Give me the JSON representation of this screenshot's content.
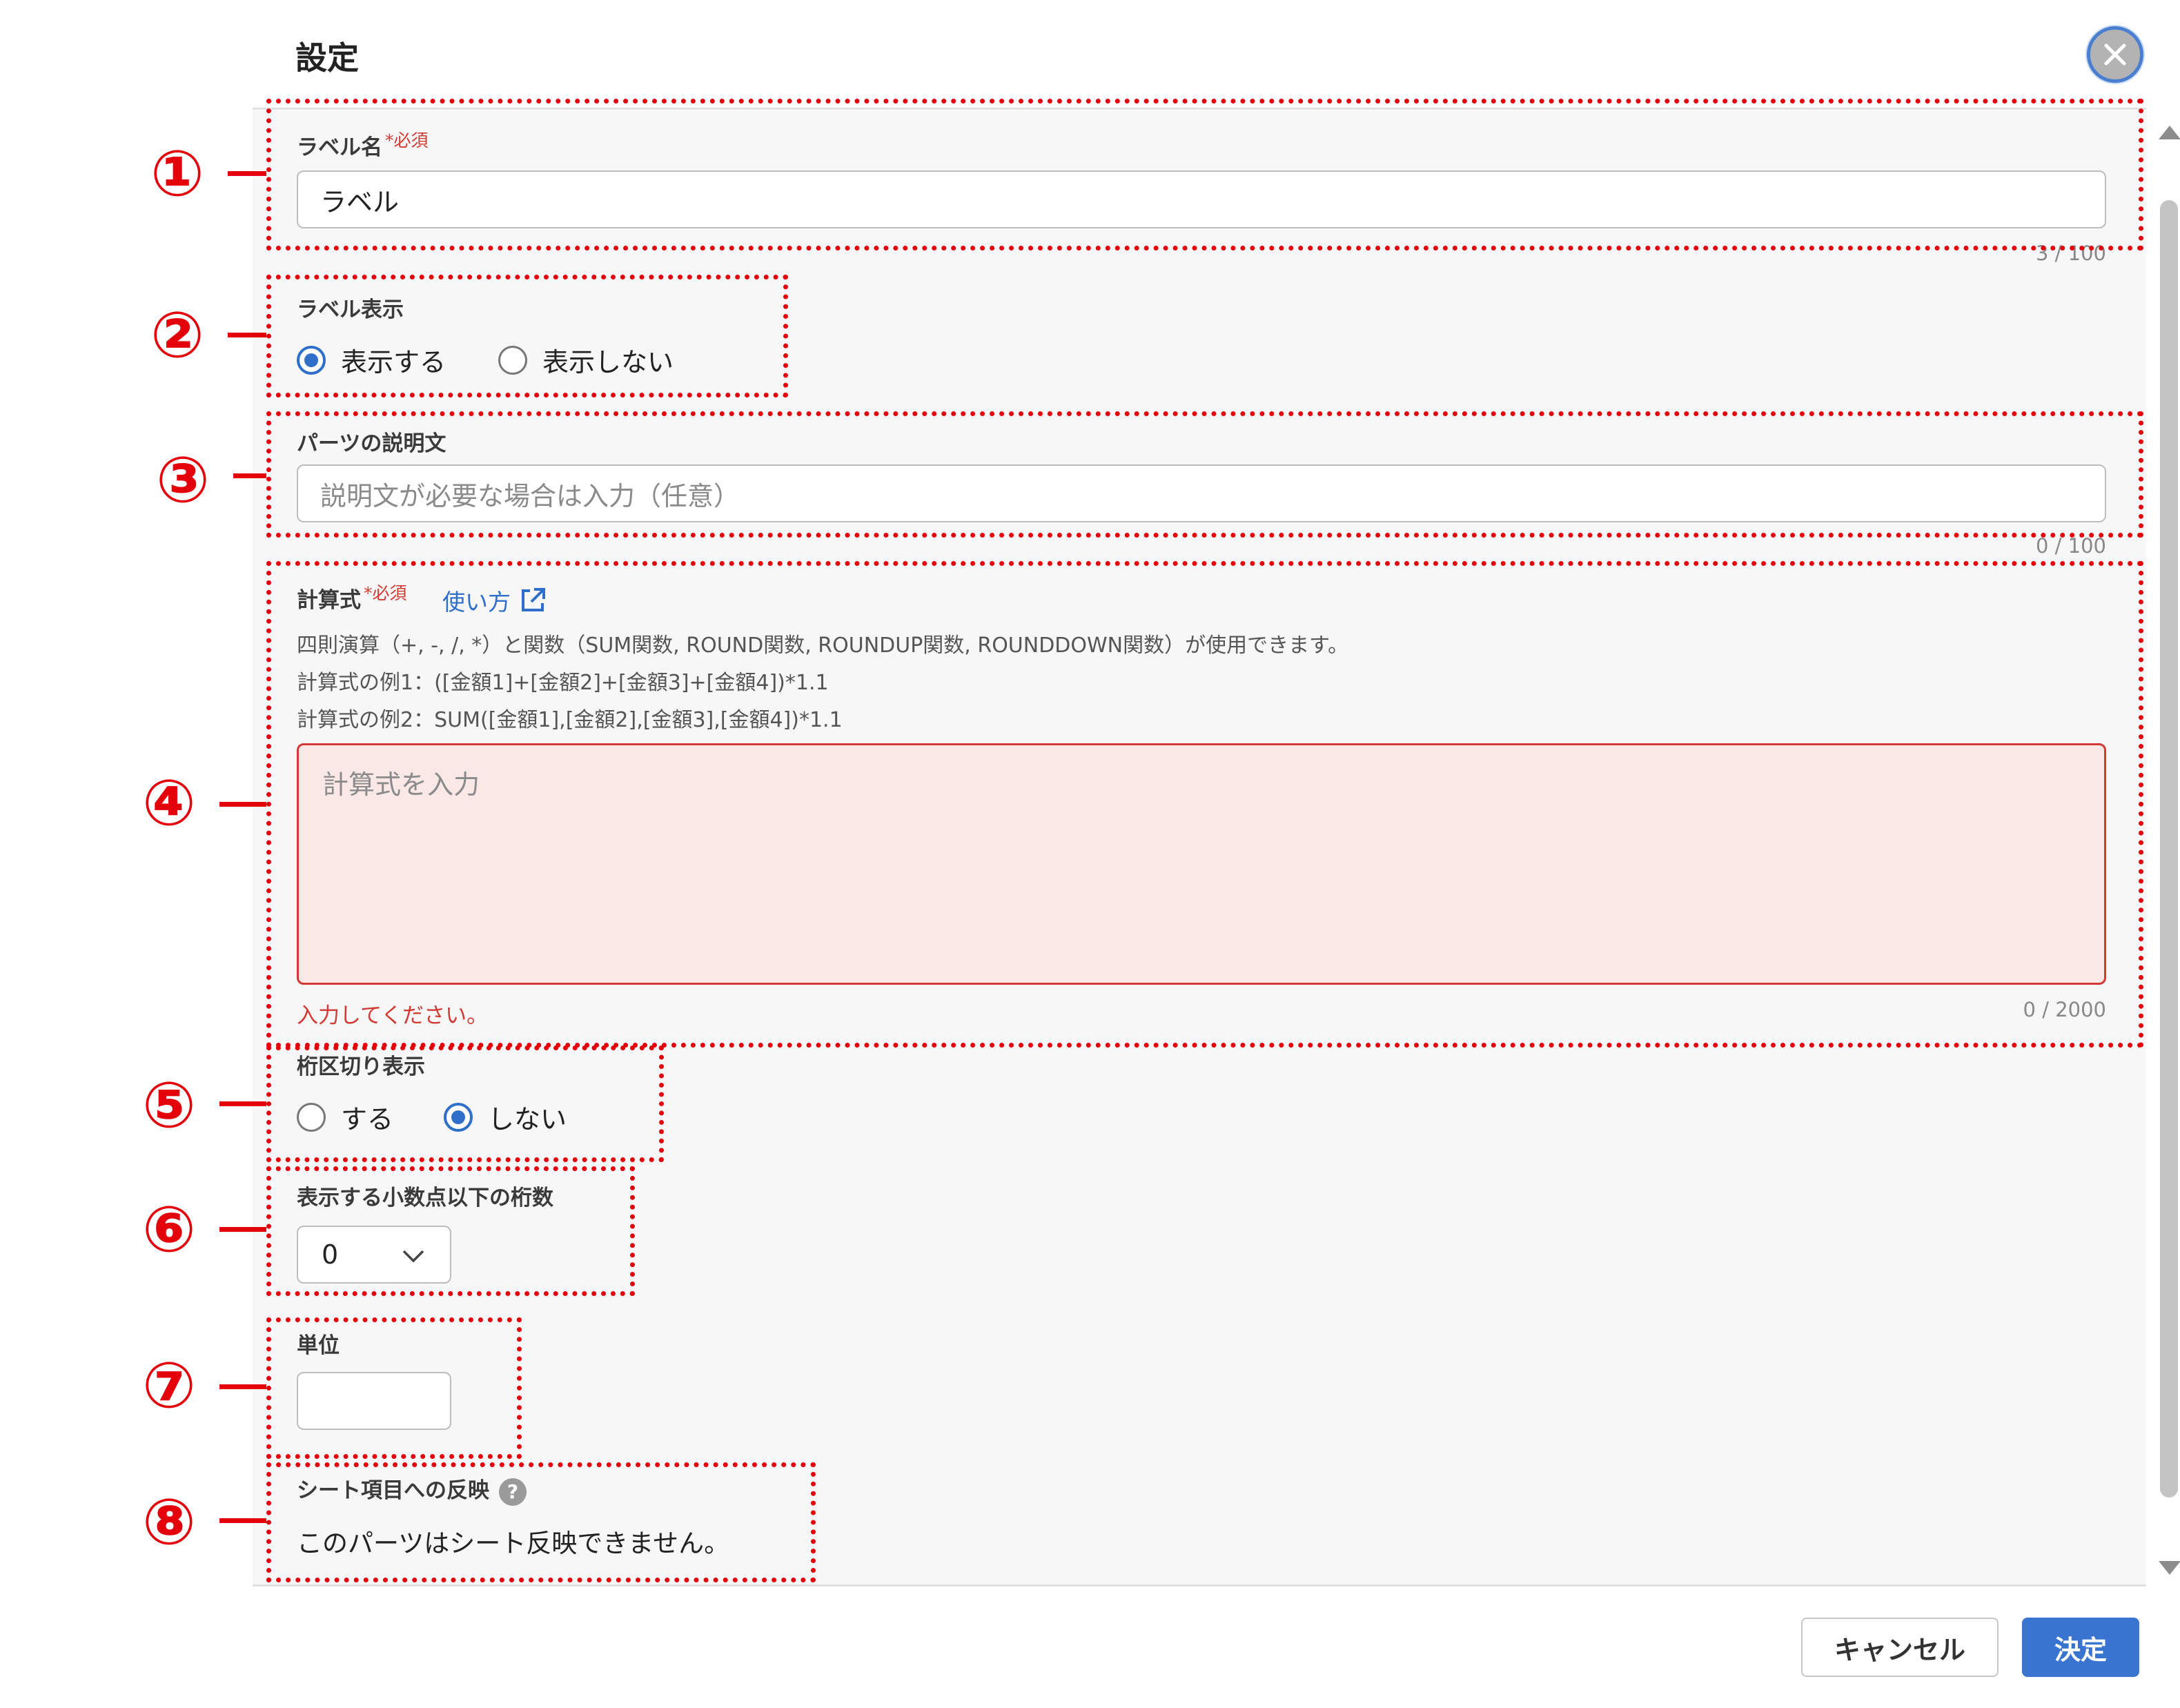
{
  "dialog": {
    "title": "設定",
    "close_icon": "close-icon"
  },
  "fields": {
    "label_name": {
      "label": "ラベル名",
      "required": "*必須",
      "value": "ラベル",
      "counter": "3 / 100"
    },
    "label_display": {
      "label": "ラベル表示",
      "options": [
        "表示する",
        "表示しない"
      ],
      "selected": "表示する"
    },
    "description": {
      "label": "パーツの説明文",
      "placeholder": "説明文が必要な場合は入力（任意）",
      "counter": "0 / 100"
    },
    "formula": {
      "label": "計算式",
      "required": "*必須",
      "link_text": "使い方",
      "help_lines": [
        "四則演算（+, -, /, *）と関数（SUM関数, ROUND関数, ROUNDUP関数, ROUNDDOWN関数）が使用できます。",
        "計算式の例1：([金額1]+[金額2]+[金額3]+[金額4])*1.1",
        "計算式の例2：SUM([金額1],[金額2],[金額3],[金額4])*1.1"
      ],
      "placeholder": "計算式を入力",
      "error": "入力してください。",
      "counter": "0 / 2000"
    },
    "thousands_separator": {
      "label": "桁区切り表示",
      "options": [
        "する",
        "しない"
      ],
      "selected": "しない"
    },
    "decimal_places": {
      "label": "表示する小数点以下の桁数",
      "value": "0"
    },
    "unit": {
      "label": "単位",
      "value": ""
    },
    "sheet_reflect": {
      "label": "シート項目への反映",
      "help_icon": "?",
      "message": "このパーツはシート反映できません。"
    }
  },
  "annotations": [
    "①",
    "②",
    "③",
    "④",
    "⑤",
    "⑥",
    "⑦",
    "⑧"
  ],
  "footer": {
    "cancel_label": "キャンセル",
    "ok_label": "決定"
  },
  "colors": {
    "annotation": "#e3000b",
    "primary": "#3a74d1",
    "error": "#d13a33"
  }
}
